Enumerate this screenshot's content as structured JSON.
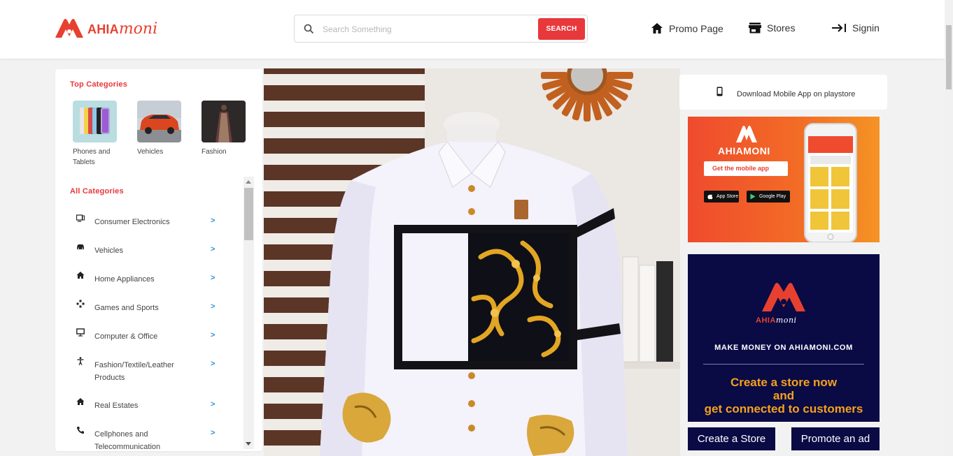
{
  "header": {
    "logo_bold": "AHIA",
    "logo_script": "moni",
    "search": {
      "placeholder": "Search Something",
      "button": "SEARCH"
    },
    "nav": [
      {
        "label": "Promo Page",
        "icon": "home-icon"
      },
      {
        "label": "Stores",
        "icon": "store-icon"
      },
      {
        "label": "Signin",
        "icon": "signin-arrow-icon"
      }
    ]
  },
  "sidebar": {
    "top_title": "Top Categories",
    "top_categories": [
      {
        "label": "Phones and Tablets"
      },
      {
        "label": "Vehicles"
      },
      {
        "label": "Fashion"
      }
    ],
    "all_title": "All Categories",
    "categories": [
      {
        "label": "Consumer Electronics",
        "icon": "electronics-icon"
      },
      {
        "label": "Vehicles",
        "icon": "car-icon"
      },
      {
        "label": "Home Appliances",
        "icon": "home-icon"
      },
      {
        "label": "Games and Sports",
        "icon": "gamepad-icon"
      },
      {
        "label": "Computer & Office",
        "icon": "monitor-icon"
      },
      {
        "label": "Fashion/Textile/Leather Products",
        "icon": "person-icon"
      },
      {
        "label": "Real Estates",
        "icon": "home-icon"
      },
      {
        "label": "Cellphones and Telecommunication",
        "icon": "phone-icon"
      }
    ],
    "chevron": ">"
  },
  "right": {
    "download_text": "Download Mobile App on playstore",
    "promo1": {
      "brand": "AHIAMONI",
      "button": "Get the mobile app",
      "app_store": "App Store",
      "google_play": "Google Play"
    },
    "promo2": {
      "brand_bold": "AHIA",
      "brand_script": "moni",
      "make_money": "MAKE MONEY ON AHIAMONI.COM",
      "cta_line1": "Create a store now",
      "cta_line2": "and",
      "cta_line3": "get connected to customers"
    },
    "buttons": {
      "create_store": "Create a Store",
      "promote_ad": "Promote an ad"
    }
  },
  "colors": {
    "brand_red": "#e8383b",
    "navy": "#0a0a45",
    "orange": "#f26a26",
    "gold": "#f5a21b",
    "link_blue": "#2f8fd6"
  }
}
